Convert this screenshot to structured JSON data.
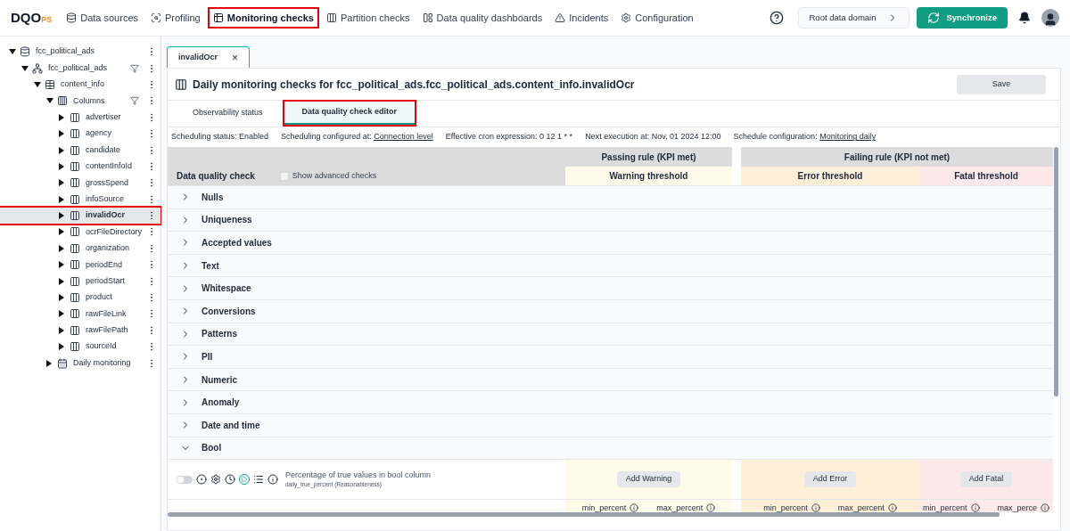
{
  "logo": {
    "main": "DQO",
    "suffix": "PS"
  },
  "nav": [
    {
      "label": "Data sources",
      "selected": false
    },
    {
      "label": "Profiling",
      "selected": false
    },
    {
      "label": "Monitoring checks",
      "selected": true
    },
    {
      "label": "Partition checks",
      "selected": false
    },
    {
      "label": "Data quality dashboards",
      "selected": false
    },
    {
      "label": "Incidents",
      "selected": false
    },
    {
      "label": "Configuration",
      "selected": false
    }
  ],
  "domain_button": "Root data domain",
  "sync_button": "Synchronize",
  "tree": [
    {
      "label": "fcc_political_ads",
      "kind": "connection",
      "expanded": true,
      "selected": false,
      "filter": false,
      "children": [
        {
          "label": "fcc_political_ads",
          "kind": "schema",
          "expanded": true,
          "selected": false,
          "filter": true,
          "children": [
            {
              "label": "content_info",
              "kind": "table",
              "expanded": true,
              "selected": false,
              "filter": false,
              "children": [
                {
                  "label": "Columns",
                  "kind": "columns",
                  "expanded": true,
                  "selected": false,
                  "filter": true,
                  "children": [
                    {
                      "label": "advertiser",
                      "kind": "column",
                      "expanded": false,
                      "selected": false,
                      "filter": false
                    },
                    {
                      "label": "agency",
                      "kind": "column",
                      "expanded": false,
                      "selected": false,
                      "filter": false
                    },
                    {
                      "label": "candidate",
                      "kind": "column",
                      "expanded": false,
                      "selected": false,
                      "filter": false
                    },
                    {
                      "label": "contentInfoId",
                      "kind": "column",
                      "expanded": false,
                      "selected": false,
                      "filter": false
                    },
                    {
                      "label": "grossSpend",
                      "kind": "column",
                      "expanded": false,
                      "selected": false,
                      "filter": false
                    },
                    {
                      "label": "infoSource",
                      "kind": "column",
                      "expanded": false,
                      "selected": false,
                      "filter": false
                    },
                    {
                      "label": "invalidOcr",
                      "kind": "column",
                      "expanded": false,
                      "selected": true,
                      "filter": false
                    },
                    {
                      "label": "ocrFileDirectory",
                      "kind": "column",
                      "expanded": false,
                      "selected": false,
                      "filter": false
                    },
                    {
                      "label": "organization",
                      "kind": "column",
                      "expanded": false,
                      "selected": false,
                      "filter": false
                    },
                    {
                      "label": "periodEnd",
                      "kind": "column",
                      "expanded": false,
                      "selected": false,
                      "filter": false
                    },
                    {
                      "label": "periodStart",
                      "kind": "column",
                      "expanded": false,
                      "selected": false,
                      "filter": false
                    },
                    {
                      "label": "product",
                      "kind": "column",
                      "expanded": false,
                      "selected": false,
                      "filter": false
                    },
                    {
                      "label": "rawFileLink",
                      "kind": "column",
                      "expanded": false,
                      "selected": false,
                      "filter": false
                    },
                    {
                      "label": "rawFilePath",
                      "kind": "column",
                      "expanded": false,
                      "selected": false,
                      "filter": false
                    },
                    {
                      "label": "sourceId",
                      "kind": "column",
                      "expanded": false,
                      "selected": false,
                      "filter": false
                    }
                  ]
                },
                {
                  "label": "Daily monitoring",
                  "kind": "monitoring",
                  "expanded": false,
                  "selected": false,
                  "filter": false
                }
              ]
            }
          ]
        }
      ]
    }
  ],
  "open_tab": {
    "label": "invalidOcr",
    "close": "×"
  },
  "title": "Daily monitoring checks for fcc_political_ads.fcc_political_ads.content_info.invalidOcr",
  "save_button": "Save",
  "subtabs": [
    {
      "label": "Observability status",
      "selected": false
    },
    {
      "label": "Data quality check editor",
      "selected": true
    }
  ],
  "schedule": [
    {
      "label": "Scheduling status: Enabled"
    },
    {
      "label": "Scheduling configured at: ",
      "link": "Connection level"
    },
    {
      "label": "Effective cron expression: 0 12 1 * *"
    },
    {
      "label": "Next execution at: Nov, 01 2024 12:00"
    },
    {
      "label": "Schedule configuration: ",
      "link": "Monitoring daily"
    }
  ],
  "table": {
    "check_header": "Data quality check",
    "advanced": {
      "label": "Show advanced checks",
      "checked": false
    },
    "passing_header": "Passing rule (KPI met)",
    "failing_header": "Failing rule (KPI not met)",
    "thresholds": [
      "Warning threshold",
      "Error threshold",
      "Fatal threshold"
    ],
    "categories": [
      {
        "label": "Nulls",
        "expanded": false
      },
      {
        "label": "Uniqueness",
        "expanded": false
      },
      {
        "label": "Accepted values",
        "expanded": false
      },
      {
        "label": "Text",
        "expanded": false
      },
      {
        "label": "Whitespace",
        "expanded": false
      },
      {
        "label": "Conversions",
        "expanded": false
      },
      {
        "label": "Patterns",
        "expanded": false
      },
      {
        "label": "PII",
        "expanded": false
      },
      {
        "label": "Numeric",
        "expanded": false
      },
      {
        "label": "Anomaly",
        "expanded": false
      },
      {
        "label": "Date and time",
        "expanded": false
      },
      {
        "label": "Bool",
        "expanded": true
      }
    ],
    "check": {
      "enabled": false,
      "name": "Percentage of true values in bool column",
      "sub": "daily_true_percent (Reasonableness)",
      "add_buttons": [
        "Add Warning",
        "Add Error",
        "Add Fatal"
      ],
      "params": [
        [
          "min_percent",
          "max_percent"
        ],
        [
          "min_percent",
          "max_percent"
        ],
        [
          "min_percent",
          "max_perce"
        ]
      ]
    }
  }
}
